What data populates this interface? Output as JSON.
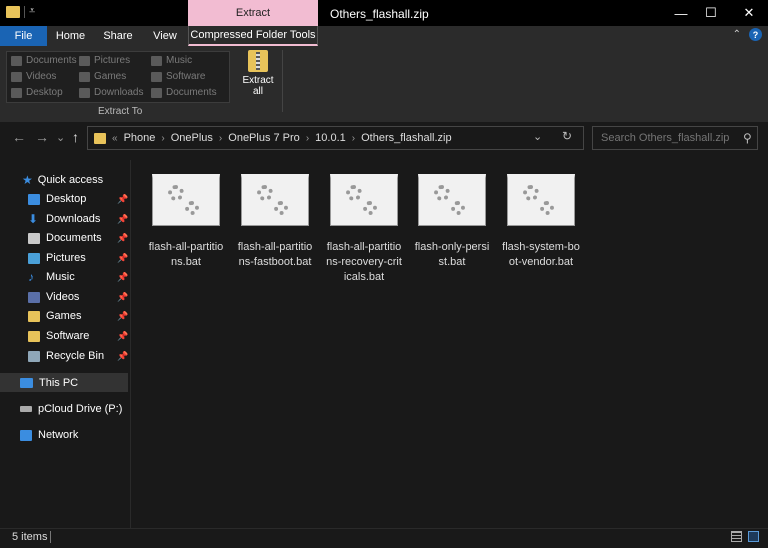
{
  "window": {
    "title": "Others_flashall.zip",
    "context_tab_header": "Extract",
    "minimize": "—",
    "maximize": "☐",
    "close": "✕"
  },
  "ribbon": {
    "tabs": [
      {
        "label": "File"
      },
      {
        "label": "Home"
      },
      {
        "label": "Share"
      },
      {
        "label": "View"
      },
      {
        "label": "Compressed Folder Tools"
      }
    ],
    "collapse_glyph": "⌃",
    "help_glyph": "?",
    "destinations": [
      {
        "label": "Documents"
      },
      {
        "label": "Pictures"
      },
      {
        "label": "Music"
      },
      {
        "label": "Videos"
      },
      {
        "label": "Games"
      },
      {
        "label": "Software"
      },
      {
        "label": "Desktop"
      },
      {
        "label": "Downloads"
      },
      {
        "label": "Documents"
      }
    ],
    "group_label": "Extract To",
    "extract_all_label": "Extract all",
    "accent_color": "#f2bcd2",
    "file_tab_color": "#1a64b4"
  },
  "navigation": {
    "back": "←",
    "forward": "→",
    "recent": "⌄",
    "up": "↑",
    "breadcrumb": [
      "Phone",
      "OnePlus",
      "OnePlus 7 Pro",
      "10.0.1",
      "Others_flashall.zip"
    ],
    "breadcrumb_prefix": "«",
    "separator": "›",
    "dropdown": "⌄",
    "refresh": "↻",
    "search_placeholder": "Search Others_flashall.zip",
    "search_glyph": "⚲"
  },
  "sidebar": {
    "quick_access": "Quick access",
    "pinned": [
      {
        "label": "Desktop",
        "icon": "desktop-icon"
      },
      {
        "label": "Downloads",
        "icon": "downloads-icon"
      },
      {
        "label": "Documents",
        "icon": "documents-icon"
      },
      {
        "label": "Pictures",
        "icon": "pictures-icon"
      },
      {
        "label": "Music",
        "icon": "music-icon"
      },
      {
        "label": "Videos",
        "icon": "videos-icon"
      },
      {
        "label": "Games",
        "icon": "folder-icon"
      },
      {
        "label": "Software",
        "icon": "folder-icon"
      },
      {
        "label": "Recycle Bin",
        "icon": "recycle-bin-icon"
      }
    ],
    "pin_glyph": "📌",
    "this_pc": "This PC",
    "pcloud": "pCloud Drive (P:)",
    "network": "Network"
  },
  "files": [
    {
      "name": "flash-all-partitions.bat"
    },
    {
      "name": "flash-all-partitions-fastboot.bat"
    },
    {
      "name": "flash-all-partitions-recovery-criticals.bat"
    },
    {
      "name": "flash-only-persist.bat"
    },
    {
      "name": "flash-system-boot-vendor.bat"
    }
  ],
  "status": {
    "item_count": "5 items"
  }
}
